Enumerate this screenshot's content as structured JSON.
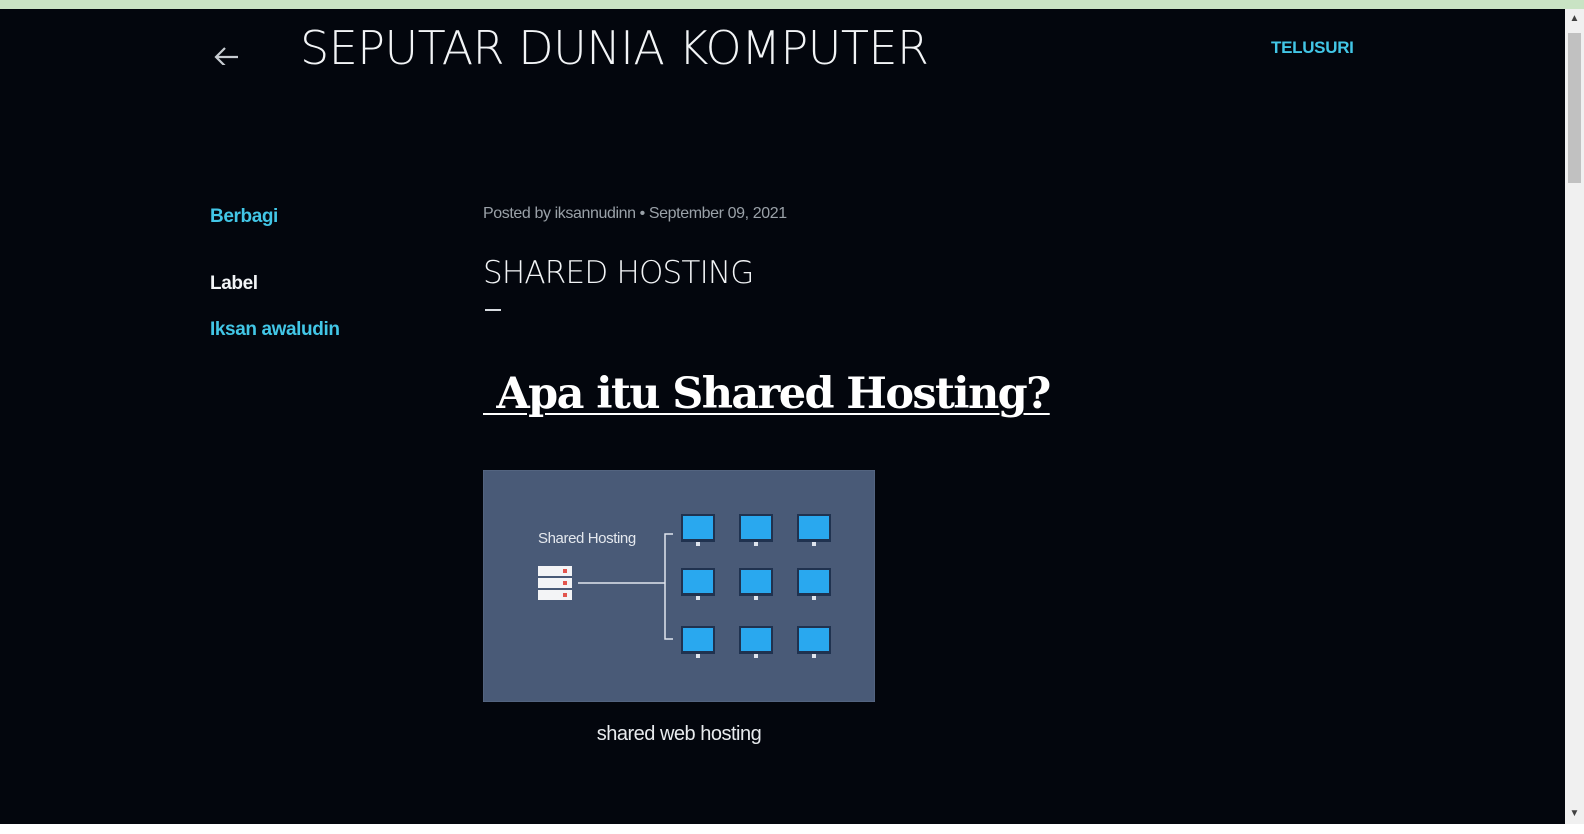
{
  "header": {
    "site_title": "SEPUTAR DUNIA KOMPUTER",
    "search_label": "TELUSURI",
    "back_icon": "arrow-left-icon"
  },
  "sidebar": {
    "share_label": "Berbagi",
    "label_heading": "Label",
    "label_link": "Iksan awaludin"
  },
  "post": {
    "meta_prefix": "Posted by ",
    "author": "iksannudinn",
    "separator": " • ",
    "date": "September 09, 2021",
    "title": "SHARED HOSTING",
    "article_heading": " Apa itu Shared Hosting?",
    "figure": {
      "label": "Shared Hosting",
      "caption": "shared web hosting",
      "server_icon": "server-icon",
      "monitor_icon": "monitor-icon"
    }
  },
  "scrollbar": {
    "up_glyph": "▲",
    "down_glyph": "▼"
  },
  "colors": {
    "background": "#03060d",
    "accent": "#42c6e6",
    "figure_bg": "#495a77",
    "monitor": "#29a8ef"
  }
}
